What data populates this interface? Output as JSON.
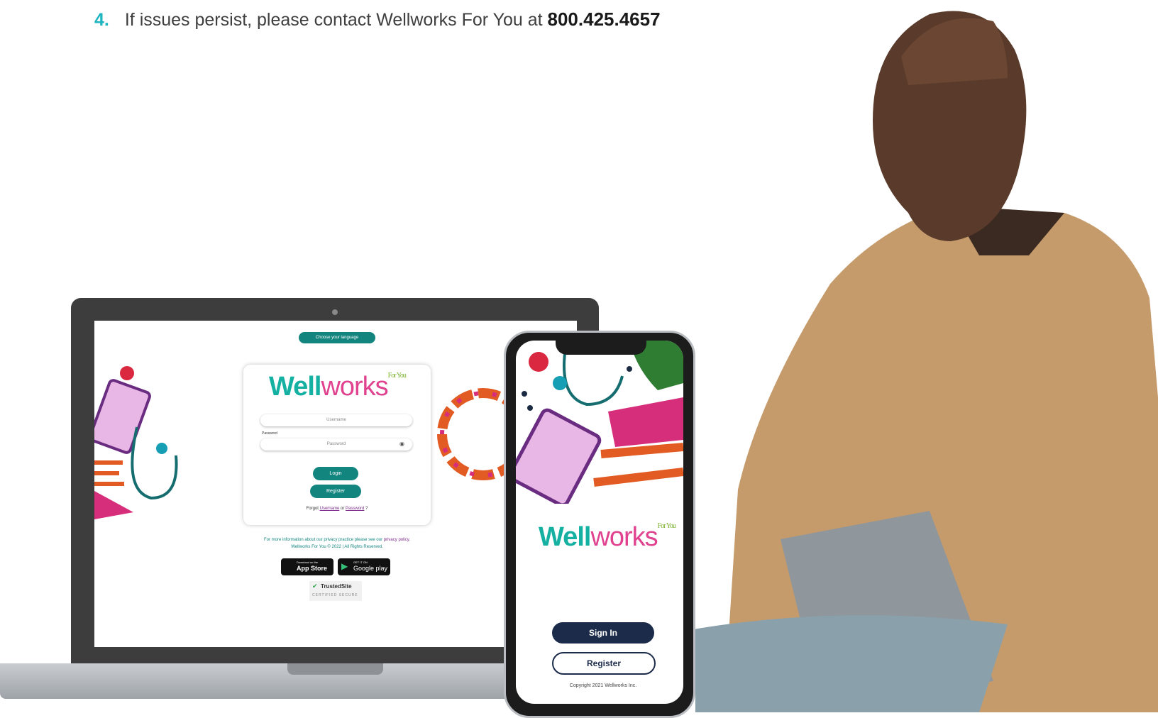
{
  "instructions": {
    "step_number": "4.",
    "text": "If issues persist, please contact Wellworks For You at",
    "phone": "800.425.4657"
  },
  "laptop_screen": {
    "language_button": "Choose your language",
    "logo": {
      "well": "Well",
      "works": "works",
      "for_you": "For You"
    },
    "username_placeholder": "Username",
    "password_label": "Password",
    "password_placeholder": "Password",
    "login_button": "Login",
    "register_button": "Register",
    "forgot": {
      "prefix": "Forgot",
      "username_link": "Username",
      "or": "or",
      "password_link": "Password",
      "suffix": "?"
    },
    "privacy_text": "For more information about our privacy practice please see our",
    "privacy_link": "privacy policy.",
    "copyright": "Wellworks For You © 2022 | All Rights Reserved.",
    "app_store": {
      "small": "Download on the",
      "big": "App Store"
    },
    "google_play": {
      "small": "GET IT ON",
      "big": "Google play"
    },
    "trusted": {
      "name": "TrustedSite",
      "sub": "CERTIFIED SECURE"
    }
  },
  "phone_screen": {
    "logo": {
      "well": "Well",
      "works": "works",
      "for_you": "For You"
    },
    "sign_in_button": "Sign In",
    "register_button": "Register",
    "copyright": "Copyright 2021 Wellworks Inc."
  },
  "colors": {
    "accent_teal": "#12857f",
    "brand_teal": "#14b1a3",
    "brand_pink": "#e0428f",
    "navy": "#1c2b4a"
  }
}
